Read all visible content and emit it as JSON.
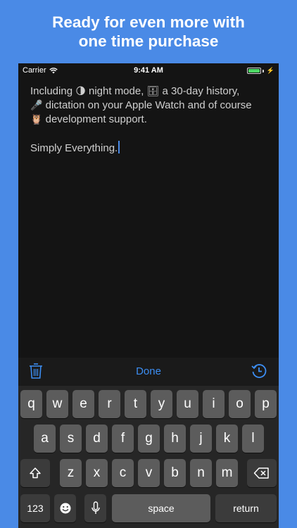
{
  "headline": {
    "line1": "Ready for even more with",
    "line2": "one time purchase"
  },
  "status_bar": {
    "carrier": "Carrier",
    "time": "9:41 AM"
  },
  "editor": {
    "p1_a": "Including ",
    "emoji_moon": "🌗",
    "p1_b": " night mode, ",
    "emoji_cabinet": "🗄",
    "p1_c": " a 30-day history,",
    "emoji_mic": "🎤",
    "p1_d": " dictation on your Apple Watch and of course",
    "emoji_owl": "🦉",
    "p1_e": " development support.",
    "p2": "Simply Everything."
  },
  "toolbar": {
    "done_label": "Done",
    "trash_icon": "trash-icon",
    "history_icon": "history-icon"
  },
  "keyboard": {
    "row1": [
      "q",
      "w",
      "e",
      "r",
      "t",
      "y",
      "u",
      "i",
      "o",
      "p"
    ],
    "row2": [
      "a",
      "s",
      "d",
      "f",
      "g",
      "h",
      "j",
      "k",
      "l"
    ],
    "row3": [
      "z",
      "x",
      "c",
      "v",
      "b",
      "n",
      "m"
    ],
    "numbers_label": "123",
    "space_label": "space",
    "return_label": "return",
    "shift_icon": "shift-icon",
    "delete_icon": "delete-icon",
    "emoji_icon": "emoji-icon",
    "mic_icon": "microphone-icon"
  },
  "colors": {
    "background": "#4a8ae6",
    "accent": "#3c8ef3",
    "battery": "#4cd964"
  }
}
